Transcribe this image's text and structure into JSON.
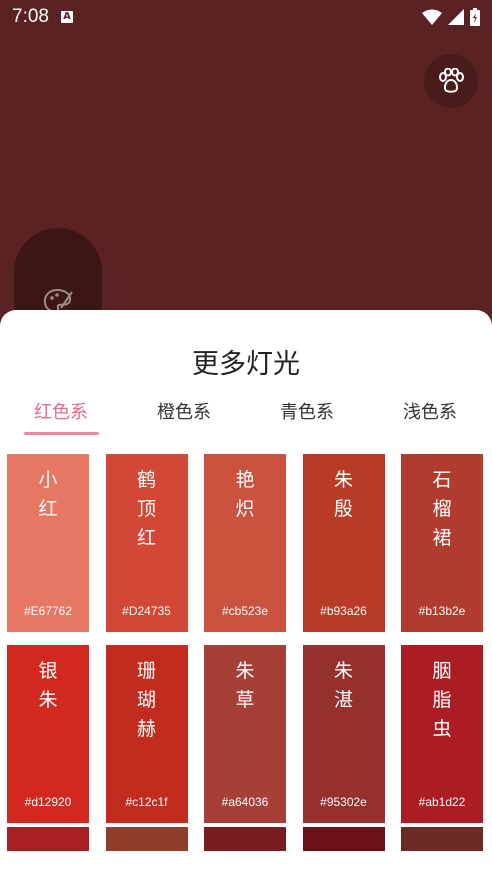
{
  "status": {
    "time": "7:08"
  },
  "sheet": {
    "title": "更多灯光",
    "tabs": [
      "红色系",
      "橙色系",
      "青色系",
      "浅色系"
    ],
    "active_tab": 0
  },
  "colors": [
    {
      "name": "小红",
      "hex": "#E67762"
    },
    {
      "name": "鹤顶红",
      "hex": "#D24735"
    },
    {
      "name": "艳炽",
      "hex": "#cb523e"
    },
    {
      "name": "朱殷",
      "hex": "#b93a26"
    },
    {
      "name": "石榴裙",
      "hex": "#b13b2e"
    },
    {
      "name": "银朱",
      "hex": "#d12920"
    },
    {
      "name": "珊瑚赫",
      "hex": "#c12c1f"
    },
    {
      "name": "朱草",
      "hex": "#a64036"
    },
    {
      "name": "朱湛",
      "hex": "#95302e"
    },
    {
      "name": "胭脂虫",
      "hex": "#ab1d22"
    }
  ],
  "partial_row_colors": [
    "#a81f24",
    "#8e3e2a",
    "#7a1d20",
    "#6a1018",
    "#6b2a22"
  ],
  "background_color": "#5a2222"
}
